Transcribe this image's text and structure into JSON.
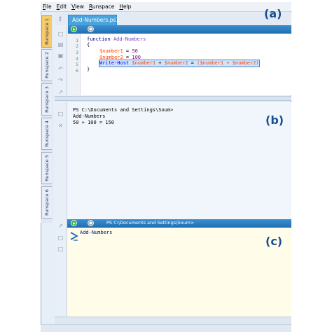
{
  "menu": [
    "File",
    "Edit",
    "View",
    "Runspace",
    "Help"
  ],
  "editor": {
    "tab_title": "Add-Numbers.ps1",
    "line_numbers": [
      "1",
      "2",
      "3",
      "4",
      "5",
      "6"
    ],
    "code": {
      "l1_keyword": "function",
      "l1_name": "Add-Numbers",
      "l2": "{",
      "l3_var": "$number1",
      "l3_op": " = ",
      "l3_val": "50",
      "l4_var": "$number2",
      "l4_op": " = ",
      "l4_val": "100",
      "l5_cmd": "Write-Host",
      "l5_var1": "$number1",
      "l5_plus1": " + ",
      "l5_var2": "$number2",
      "l5_eq": " = ",
      "l5_expr": "($number1 + $number2)",
      "l6": "}"
    }
  },
  "runspaces": [
    "Runspace 1",
    "Runspace 2",
    "Runspace 3",
    "Runspace 4",
    "Runspace 5",
    "Runspace 6"
  ],
  "output": {
    "lines": [
      "PS C:\\Documents and Settings\\Soum>",
      "Add-Numbers",
      "50 + 100 = 150"
    ]
  },
  "command": {
    "prompt": "PS C:\\Documents and Settings\\Soum>",
    "input": "Add-Numbers"
  },
  "labels": {
    "a": "(a)",
    "b": "(b)",
    "c": "(c)"
  },
  "colors": {
    "accent": "#1f6fb2",
    "active_tab": "#f6c96a",
    "label": "#1a4f93"
  }
}
